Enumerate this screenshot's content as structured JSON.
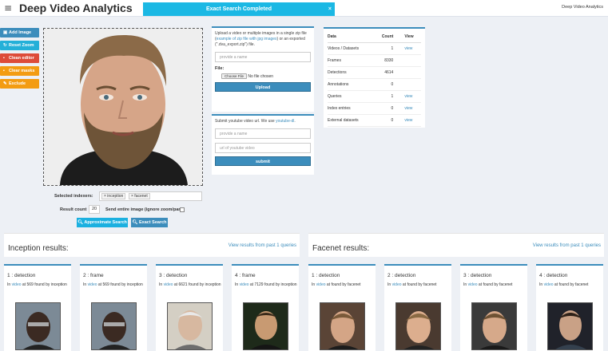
{
  "header": {
    "brand": "Deep Video Analytics",
    "menu_icon": "hamburger-icon",
    "top_right_link": "Deep Video Analytics"
  },
  "toast": {
    "message": "Exact Search Completed",
    "close": "×"
  },
  "left_buttons": [
    {
      "label": "Add Image",
      "icon": "image-icon",
      "color": "#3c8dbc"
    },
    {
      "label": "Reset Zoom",
      "icon": "refresh-icon",
      "color": "#24b0d8"
    },
    {
      "label": "Clean editor",
      "icon": "trash-icon",
      "color": "#dd4b39"
    },
    {
      "label": "Clear masks",
      "icon": "trash-icon",
      "color": "#f39c12"
    },
    {
      "label": "Exclude",
      "icon": "pencil-icon",
      "color": "#f39c12"
    }
  ],
  "search": {
    "indexers_label": "Selected indexers:",
    "indexers": [
      "× inception",
      "× facenet"
    ],
    "result_count_label": "Result count",
    "result_count": "20",
    "entire_image_label": "Send entire image (ignore zoom/pan)",
    "approx_button": "Approximate Search",
    "exact_button": "Exact Search"
  },
  "upload": {
    "text_1": "Upload a video or multiple images in a single zip file (",
    "link_1": "example of zip file with jpg images",
    "text_2": ") or an exported (\"",
    "text_3": ".dva_export.zip\") file.",
    "name_placeholder": "provide a name",
    "file_label": "File:",
    "choose_file": "Choose File",
    "no_file": "No file chosen",
    "submit": "Upload"
  },
  "youtube": {
    "text": "Submit youtube video url. We use ",
    "link": "youtube-dl",
    "text_end": ".",
    "name_placeholder": "provide a name",
    "url_placeholder": "url of youtube video",
    "submit": "submit"
  },
  "stats": {
    "headers": [
      "Data",
      "Count",
      "View"
    ],
    "rows": [
      {
        "label": "Videos / Datasets",
        "count": "1",
        "view": "view"
      },
      {
        "label": "Frames",
        "count": "8330",
        "view": ""
      },
      {
        "label": "Detections",
        "count": "4614",
        "view": ""
      },
      {
        "label": "Annotations",
        "count": "0",
        "view": ""
      },
      {
        "label": "Queries",
        "count": "1",
        "view": "view"
      },
      {
        "label": "Index entries",
        "count": "0",
        "view": "view"
      },
      {
        "label": "External datasets",
        "count": "0",
        "view": "view"
      }
    ]
  },
  "inception": {
    "title": "Inception results:",
    "link": "View results from past 1 queries",
    "cards": [
      {
        "title": "1 : detection",
        "link": "video",
        "desc": " at 569 found by inception",
        "thumb": "face-thumb-1"
      },
      {
        "title": "2 : frame",
        "link": "video",
        "desc": " at 569 found by inception",
        "thumb": "face-thumb-2"
      },
      {
        "title": "3 : detection",
        "link": "video",
        "desc": " at 6621 found by inception",
        "thumb": "face-thumb-3"
      },
      {
        "title": "4 : frame",
        "link": "video",
        "desc": " at 7129 found by inception",
        "thumb": "face-thumb-4"
      }
    ]
  },
  "facenet": {
    "title": "Facenet results:",
    "link": "View results from past 1 queries",
    "cards": [
      {
        "title": "1 : detection",
        "link": "video",
        "desc": " at found by facenet",
        "thumb": "face-thumb-5"
      },
      {
        "title": "2 : detection",
        "link": "video",
        "desc": " at found by facenet",
        "thumb": "face-thumb-6"
      },
      {
        "title": "3 : detection",
        "link": "video",
        "desc": " at found by facenet",
        "thumb": "face-thumb-7"
      },
      {
        "title": "4 : detection",
        "link": "video",
        "desc": " at found by facenet",
        "thumb": "face-thumb-8"
      }
    ]
  }
}
